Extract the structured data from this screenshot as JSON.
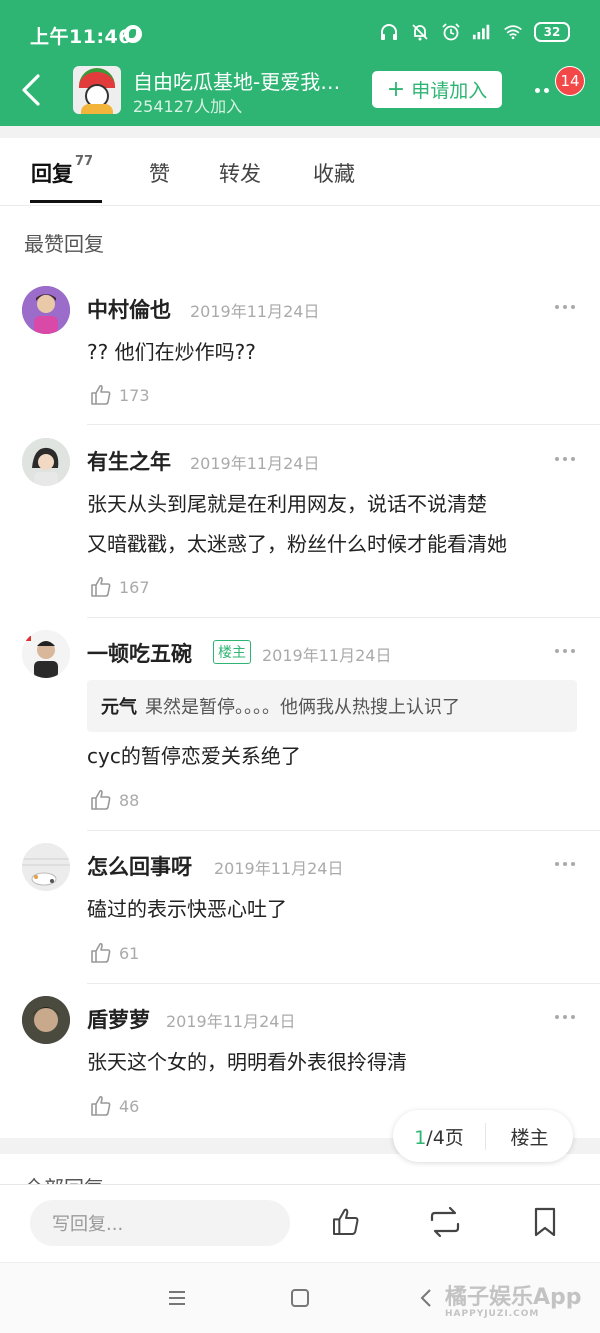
{
  "status_bar": {
    "time": "上午11:46",
    "battery": "32"
  },
  "header": {
    "group_name": "自由吃瓜基地-更爱我…",
    "member_count": "254127人加入",
    "join_label": "申请加入",
    "notification_count": "14"
  },
  "tabs": [
    {
      "label": "回复",
      "count": "77",
      "active": true
    },
    {
      "label": "赞"
    },
    {
      "label": "转发"
    },
    {
      "label": "收藏"
    }
  ],
  "section_title": "最赞回复",
  "comments": [
    {
      "name": "中村倫也",
      "date": "2019年11月24日",
      "lines": [
        "?? 他们在炒作吗??"
      ],
      "likes": "173"
    },
    {
      "name": "有生之年",
      "date": "2019年11月24日",
      "lines": [
        "张天从头到尾就是在利用网友，说话不说清楚",
        "又暗戳戳，太迷惑了，粉丝什么时候才能看清她"
      ],
      "likes": "167"
    },
    {
      "name": "一顿吃五碗",
      "badge": "楼主",
      "date": "2019年11月24日",
      "quote_author": "元气",
      "quote_text": "果然是暂停。。。。他俩我从热搜上认识了",
      "lines": [
        "cyc的暂停恋爱关系绝了"
      ],
      "likes": "88"
    },
    {
      "name": "怎么回事呀",
      "date": "2019年11月24日",
      "lines": [
        "磕过的表示快恶心吐了"
      ],
      "likes": "61"
    },
    {
      "name": "盾萝萝",
      "date": "2019年11月24日",
      "lines": [
        "张天这个女的，明明看外表很拎得清"
      ],
      "likes": "46"
    }
  ],
  "pager": {
    "current": "1",
    "total": "/4页",
    "owner_label": "楼主"
  },
  "all_replies_title": "全部回复",
  "reply_bar": {
    "placeholder": "写回复..."
  },
  "watermark": {
    "main": "橘子娱乐App",
    "sub": "HAPPYJUZI.COM"
  },
  "colors": {
    "brand_green": "#2eb573",
    "badge_red": "#f24848"
  }
}
